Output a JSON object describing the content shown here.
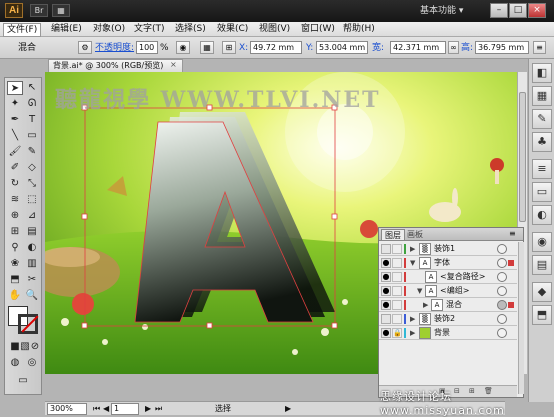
{
  "app": {
    "logo": "Ai",
    "title_buttons": [
      "Br",
      "▦"
    ],
    "workspace": "基本功能 ▾",
    "win_min": "–",
    "win_max": "□",
    "win_close": "×"
  },
  "menu": [
    "文件(F)",
    "编辑(E)",
    "对象(O)",
    "文字(T)",
    "选择(S)",
    "效果(C)",
    "视图(V)",
    "窗口(W)",
    "帮助(H)"
  ],
  "control": {
    "mode_label": "混合",
    "opacity_label": "不透明度:",
    "opacity_value": "100",
    "percent": "%",
    "x_label": "X:",
    "x_value": "49.72 mm",
    "y_label": "Y:",
    "y_value": "53.004 mm",
    "w_label": "宽:",
    "w_value": "42.371 mm",
    "h_label": "高:",
    "h_value": "36.795 mm"
  },
  "document": {
    "tab_title": "背景.ai* @ 300% (RGB/预览)",
    "tab_close": "×",
    "canvas_watermark": "聽龍視學 WWW.TLVI.NET"
  },
  "layers_panel": {
    "tab_layers": "图层",
    "tab_artboards": "画板",
    "rows": [
      {
        "name": "装饰1",
        "color": "#3fa23f"
      },
      {
        "name": "字体",
        "color": "#d23c3c"
      },
      {
        "name": "<复合路径>",
        "color": "#d23c3c"
      },
      {
        "name": "<编组>",
        "color": "#d23c3c"
      },
      {
        "name": "混合",
        "color": "#d23c3c"
      },
      {
        "name": "装饰2",
        "color": "#3b5bd6"
      },
      {
        "name": "背景",
        "color": "#2fb8d6"
      }
    ]
  },
  "status": {
    "zoom": "300%",
    "page": "1",
    "mode": "选择"
  },
  "watermark": "思缘设计论坛 www.missyuan.com"
}
